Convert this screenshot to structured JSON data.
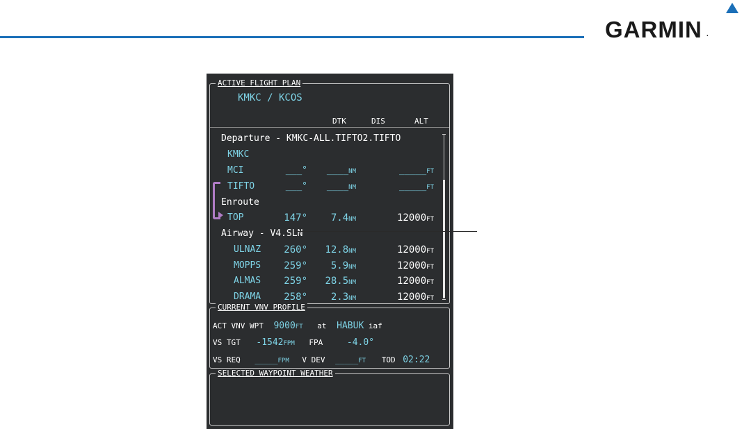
{
  "brand": {
    "name": "GARMIN",
    "reg": ".",
    "accent": "#1b6fb8"
  },
  "flight_plan": {
    "title": "ACTIVE FLIGHT PLAN",
    "route": "KMKC / KCOS",
    "headers": {
      "dtk": "DTK",
      "dis": "DIS",
      "alt": "ALT"
    },
    "rows": [
      {
        "name": "Departure - KMKC-ALL.TIFTO2.TIFTO",
        "type": "section"
      },
      {
        "name": "KMKC",
        "type": "waypoint",
        "dtk": "",
        "dis": "",
        "dis_unit": "",
        "alt": "",
        "alt_unit": ""
      },
      {
        "name": "MCI",
        "type": "waypoint",
        "dtk": "___°",
        "dis": "____",
        "dis_unit": "NM",
        "alt": "_____",
        "alt_unit": "FT"
      },
      {
        "name": "TIFTO",
        "type": "waypoint",
        "dtk": "___°",
        "dis": "____",
        "dis_unit": "NM",
        "alt": "_____",
        "alt_unit": "FT"
      },
      {
        "name": "Enroute",
        "type": "section"
      },
      {
        "name": "TOP",
        "type": "waypoint",
        "dtk": "147°",
        "dis": "7.4",
        "dis_unit": "NM",
        "alt": "12000",
        "alt_unit": "FT"
      },
      {
        "name": "Airway - V4.SLN",
        "type": "section"
      },
      {
        "name": "ULNAZ",
        "type": "airway",
        "dtk": "260°",
        "dis": "12.8",
        "dis_unit": "NM",
        "alt": "12000",
        "alt_unit": "FT"
      },
      {
        "name": "MOPPS",
        "type": "airway",
        "dtk": "259°",
        "dis": "5.9",
        "dis_unit": "NM",
        "alt": "12000",
        "alt_unit": "FT"
      },
      {
        "name": "ALMAS",
        "type": "airway",
        "dtk": "259°",
        "dis": "28.5",
        "dis_unit": "NM",
        "alt": "12000",
        "alt_unit": "FT"
      },
      {
        "name": "DRAMA",
        "type": "airway",
        "dtk": "258°",
        "dis": "2.3",
        "dis_unit": "NM",
        "alt": "12000",
        "alt_unit": "FT"
      }
    ]
  },
  "vnv": {
    "title": "CURRENT VNV PROFILE",
    "act_label": "ACT VNV WPT",
    "act_alt": "9000",
    "act_alt_unit": "FT",
    "at_label": "at",
    "act_wpt": "HABUK",
    "act_wpt_type": "iaf",
    "vs_tgt_label": "VS TGT",
    "vs_tgt": "-1542",
    "vs_tgt_unit": "FPM",
    "fpa_label": "FPA",
    "fpa": "-4.0°",
    "vs_req_label": "VS REQ",
    "vs_req": "_____",
    "vs_req_unit": "FPM",
    "vdev_label": "V DEV",
    "vdev": "_____",
    "vdev_unit": "FT",
    "tod_label": "TOD",
    "tod": "02:22"
  },
  "weather": {
    "title": "SELECTED WAYPOINT WEATHER"
  },
  "colors": {
    "screen_bg": "#2b2d2f",
    "cyan": "#7ed3e6",
    "bracket": "#b07cc6"
  }
}
